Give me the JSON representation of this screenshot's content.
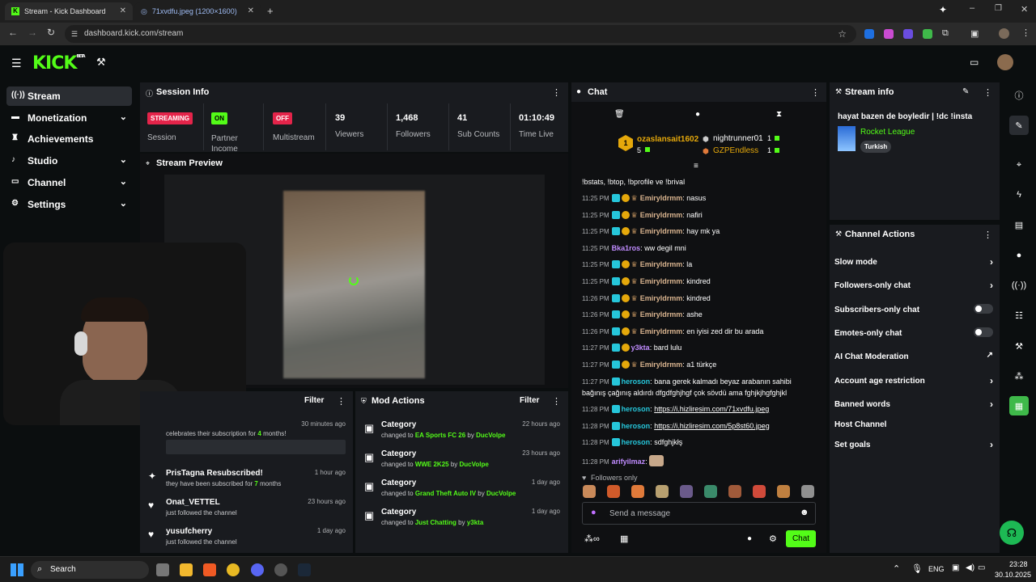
{
  "browser": {
    "tabs": [
      {
        "title": "Stream - Kick Dashboard"
      },
      {
        "title": "71xvdfu.jpeg (1200×1600)"
      }
    ],
    "url": "dashboard.kick.com/stream"
  },
  "sidebar": {
    "items": [
      {
        "label": "Stream",
        "icon": "broadcast-icon",
        "expandable": false
      },
      {
        "label": "Monetization",
        "icon": "card-icon",
        "expandable": true
      },
      {
        "label": "Achievements",
        "icon": "trophy-icon",
        "expandable": false
      },
      {
        "label": "Studio",
        "icon": "bell-icon",
        "expandable": true
      },
      {
        "label": "Channel",
        "icon": "tv-icon",
        "expandable": true
      },
      {
        "label": "Settings",
        "icon": "gear-icon",
        "expandable": true
      }
    ]
  },
  "session": {
    "title": "Session Info",
    "stats": [
      {
        "badge": "STREAMING",
        "label": "Session",
        "badge_color": "#e4244a"
      },
      {
        "badge": "ON",
        "label": "Partner Income",
        "badge_color": "#53fc18"
      },
      {
        "badge": "OFF",
        "label": "Multistream",
        "badge_color": "#e4244a"
      },
      {
        "value": "39",
        "label": "Viewers"
      },
      {
        "value": "1,468",
        "label": "Followers"
      },
      {
        "value": "41",
        "label": "Sub Counts"
      },
      {
        "value": "01:10:49",
        "label": "Time Live"
      }
    ]
  },
  "preview": {
    "title": "Stream Preview"
  },
  "activity": {
    "filter_label": "Filter",
    "items": [
      {
        "name": "",
        "time": "30 minutes ago",
        "text": "celebrates their subscription for ",
        "highlight": "4",
        "suffix": " months!"
      },
      {
        "name": "PrisTagna Resubscribed!",
        "time": "1 hour ago",
        "text": "they have been subscribed for ",
        "highlight": "7",
        "suffix": " months"
      },
      {
        "name": "Onat_VETTEL",
        "time": "23 hours ago",
        "text": "just followed the channel"
      },
      {
        "name": "yusufcherry",
        "time": "1 day ago",
        "text": "just followed the channel"
      }
    ]
  },
  "mod": {
    "title": "Mod Actions",
    "filter_label": "Filter",
    "items": [
      {
        "title": "Category",
        "time": "22 hours ago",
        "prefix": "changed to ",
        "target": "EA Sports FC 26",
        "by": " by ",
        "user": "DucVolpe"
      },
      {
        "title": "Category",
        "time": "23 hours ago",
        "prefix": "changed to ",
        "target": "WWE 2K25",
        "by": " by ",
        "user": "DucVolpe"
      },
      {
        "title": "Category",
        "time": "1 day ago",
        "prefix": "changed to ",
        "target": "Grand Theft Auto IV",
        "by": " by ",
        "user": "DucVolpe"
      },
      {
        "title": "Category",
        "time": "1 day ago",
        "prefix": "changed to ",
        "target": "Just Chatting",
        "by": " by ",
        "user": "y3kta"
      }
    ]
  },
  "chat": {
    "title": "Chat",
    "leaders": [
      {
        "name": "ozaslansait1602",
        "count": "5"
      },
      {
        "name": "nightrunner01",
        "count": "1"
      },
      {
        "name": "GZPEndless",
        "count": "1"
      }
    ],
    "top_cut": "!bstats, !btop, !bprofile ve !brival",
    "messages": [
      {
        "time": "11:25 PM",
        "user": "Emiryldrmm",
        "color": "#d9b48f",
        "text": "nasus",
        "badges": true
      },
      {
        "time": "11:25 PM",
        "user": "Emiryldrmm",
        "color": "#d9b48f",
        "text": "nafiri",
        "badges": true
      },
      {
        "time": "11:25 PM",
        "user": "Emiryldrmm",
        "color": "#d9b48f",
        "text": "hay mk ya",
        "badges": true
      },
      {
        "time": "11:25 PM",
        "user": "Bka1ros",
        "color": "#c08cff",
        "text": "ww degil mni",
        "badges": false
      },
      {
        "time": "11:25 PM",
        "user": "Emiryldrmm",
        "color": "#d9b48f",
        "text": "la",
        "badges": true
      },
      {
        "time": "11:25 PM",
        "user": "Emiryldrmm",
        "color": "#d9b48f",
        "text": "kindred",
        "badges": true
      },
      {
        "time": "11:26 PM",
        "user": "Emiryldrmm",
        "color": "#d9b48f",
        "text": "kindred",
        "badges": true
      },
      {
        "time": "11:26 PM",
        "user": "Emiryldrmm",
        "color": "#d9b48f",
        "text": "ashe",
        "badges": true
      },
      {
        "time": "11:26 PM",
        "user": "Emiryldrmm",
        "color": "#d9b48f",
        "text": "en iyisi zed dir bu arada",
        "badges": true
      },
      {
        "time": "11:27 PM",
        "user": "y3kta",
        "color": "#c08cff",
        "text": "bard lulu",
        "badges": true
      },
      {
        "time": "11:27 PM",
        "user": "Emiryldrmm",
        "color": "#d9b48f",
        "text": "a1 türkçe",
        "badges": true
      }
    ],
    "long_msg": {
      "time": "11:27 PM",
      "user": "heroson",
      "line1": "bana gerek kalmadı beyaz arabanın sahibi",
      "line2": "bağınış çağınış aldırdı dfgdfghjhgf çok sövdü ama fghjkjhgfghjkl"
    },
    "link_msgs": [
      {
        "time": "11:28 PM",
        "user": "heroson",
        "text": "https://i.hizliresim.com/71xvdfu.jpeg"
      },
      {
        "time": "11:28 PM",
        "user": "heroson",
        "text": "https://i.hizliresim.com/5p8st60.jpeg"
      },
      {
        "time": "11:28 PM",
        "user": "heroson",
        "text": "sdfghjkłş"
      }
    ],
    "last_msg": {
      "time": "11:28 PM",
      "user": "arifyilmaz"
    },
    "followers_only": "Followers only",
    "placeholder": "Send a message",
    "send_label": "Chat"
  },
  "stream_info": {
    "title": "Stream info",
    "stream_title": "hayat bazen de boyledir | !dc !insta",
    "category": "Rocket League",
    "tag": "Turkish"
  },
  "channel_actions": {
    "title": "Channel Actions",
    "items": [
      {
        "label": "Slow mode",
        "control": "chevron"
      },
      {
        "label": "Followers-only chat",
        "control": "chevron"
      },
      {
        "label": "Subscribers-only chat",
        "control": "toggle"
      },
      {
        "label": "Emotes-only chat",
        "control": "toggle"
      },
      {
        "label": "AI Chat Moderation",
        "control": "external"
      },
      {
        "label": "Account age restriction",
        "control": "chevron"
      },
      {
        "label": "Banned words",
        "control": "chevron"
      },
      {
        "label": "Host Channel",
        "control": "none"
      },
      {
        "label": "Set goals",
        "control": "chevron"
      }
    ]
  },
  "taskbar": {
    "search_label": "Search",
    "lang": "ENG",
    "time": "23:28",
    "date": "30.10.2025"
  },
  "colors": {
    "accent": "#53fc18",
    "panel": "#191b1f",
    "bg": "#0b0e0f"
  }
}
